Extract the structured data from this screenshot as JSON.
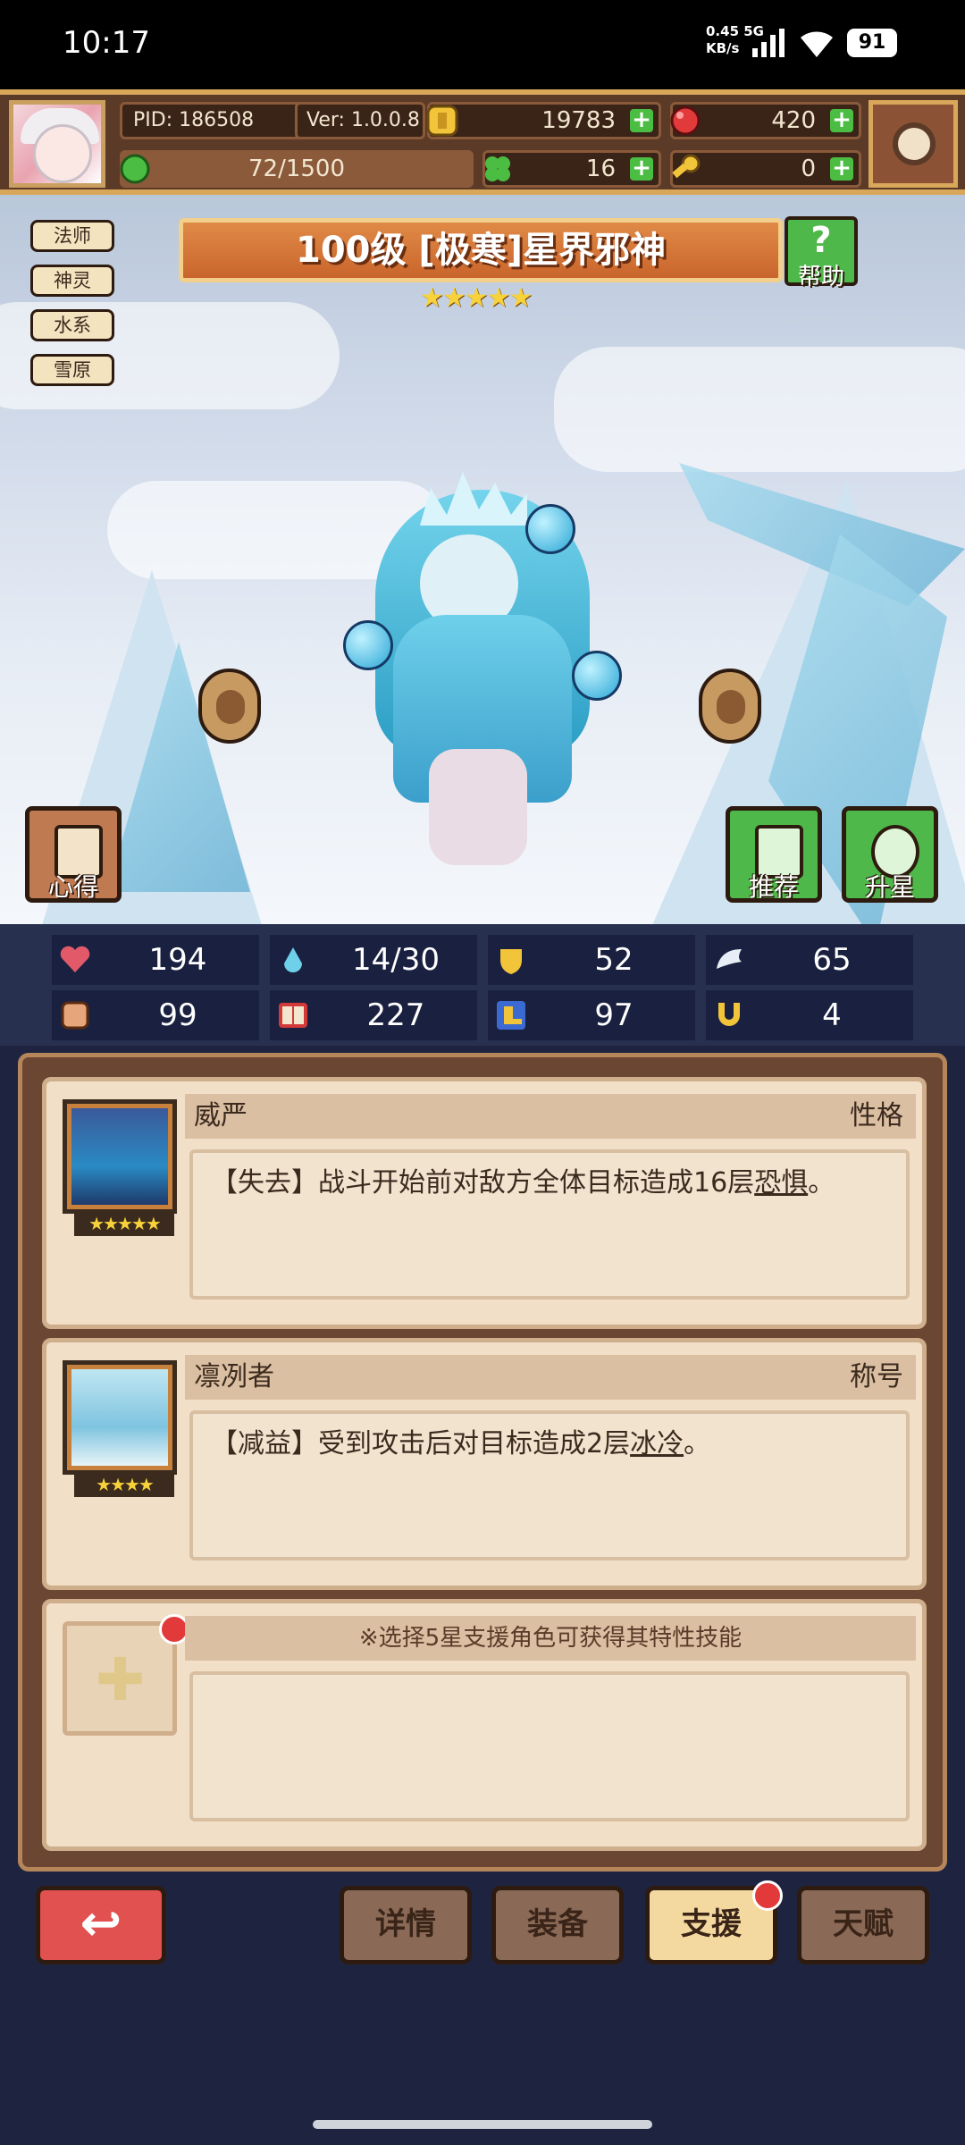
{
  "status": {
    "time": "10:17",
    "speed_top": "0.45",
    "speed_bottom": "KB/s",
    "network": "5G",
    "battery": "91"
  },
  "profile": {
    "pid": "PID: 186508",
    "ver": "Ver: 1.0.0.8",
    "gold": "19783",
    "gems": "420",
    "exp": "72/1500",
    "clover": "16",
    "keys": "0"
  },
  "tags": [
    "法师",
    "神灵",
    "水系",
    "雪原"
  ],
  "hero": {
    "title": "100级 [极寒]星界邪神",
    "stars": "★★★★★",
    "help_label": "帮助",
    "help_glyph": "?"
  },
  "side_buttons": {
    "insight": "心得",
    "recommend": "推荐",
    "star_up": "升星"
  },
  "stats": [
    "194",
    "14/30",
    "52",
    "65",
    "99",
    "227",
    "97",
    "4"
  ],
  "stat_icons": [
    "heart-icon",
    "water-drop-icon",
    "shield-icon",
    "wing-icon",
    "fist-icon",
    "spellbook-icon",
    "boot-icon",
    "horseshoe-icon"
  ],
  "cards": [
    {
      "name": "威严",
      "kind": "性格",
      "stars": "★★★★★",
      "prefix": "【失去】战斗开始前对敌方全体目标造成16层",
      "keyword": "恐惧",
      "suffix": "。"
    },
    {
      "name": "凛冽者",
      "kind": "称号",
      "stars": "★★★★",
      "prefix": "【减益】受到攻击后对目标造成2层",
      "keyword": "冰冷",
      "suffix": "。"
    }
  ],
  "support_hint": "※选择5星支援角色可获得其特性技能",
  "nav": {
    "back": "↩",
    "details": "详情",
    "equip": "装备",
    "support": "支援",
    "talent": "天赋"
  },
  "colors": {
    "accent_gold": "#d9a75a",
    "panel_brown": "#6b4632",
    "active_tab": "#f3d9a0",
    "notify_red": "#e23a3a"
  }
}
